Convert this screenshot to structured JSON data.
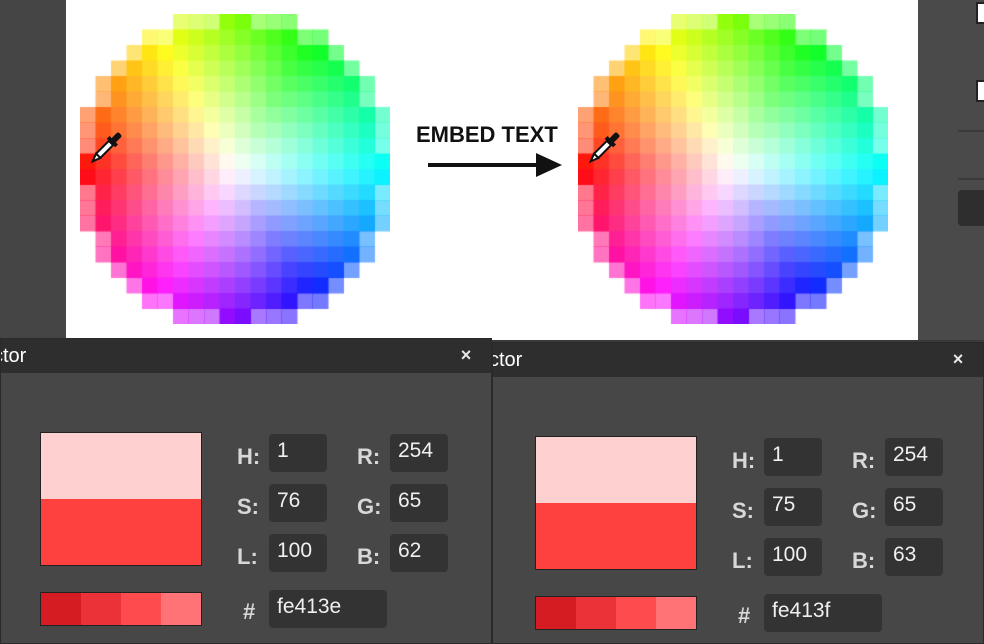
{
  "canvas": {
    "embed_text": "EMBED TEXT"
  },
  "panels": [
    {
      "title": "ctor",
      "close": "×",
      "swatch_top": "#ffd0d0",
      "swatch_bottom": "#fe413e",
      "palette": [
        "#d41c22",
        "#ea3238",
        "#fd4b4e",
        "#ff7276"
      ],
      "fields": {
        "H": "1",
        "S": "76",
        "L": "100",
        "R": "254",
        "G": "65",
        "B": "62"
      },
      "labels": {
        "H": "H:",
        "S": "S:",
        "L": "L:",
        "R": "R:",
        "G": "G:",
        "B": "B:",
        "hex": "#"
      },
      "hex": "fe413e"
    },
    {
      "title": "ctor",
      "close": "×",
      "swatch_top": "#ffd0d0",
      "swatch_bottom": "#fe413f",
      "palette": [
        "#d41c22",
        "#ea3238",
        "#fd4b4e",
        "#ff7276"
      ],
      "fields": {
        "H": "1",
        "S": "75",
        "L": "100",
        "R": "254",
        "G": "65",
        "B": "63"
      },
      "labels": {
        "H": "H:",
        "S": "S:",
        "L": "L:",
        "R": "R:",
        "G": "G:",
        "B": "B:",
        "hex": "#"
      },
      "hex": "fe413f"
    }
  ],
  "icons": {
    "eyedropper": "eyedropper-icon",
    "arrow": "arrow-right-icon",
    "close": "close-icon"
  }
}
